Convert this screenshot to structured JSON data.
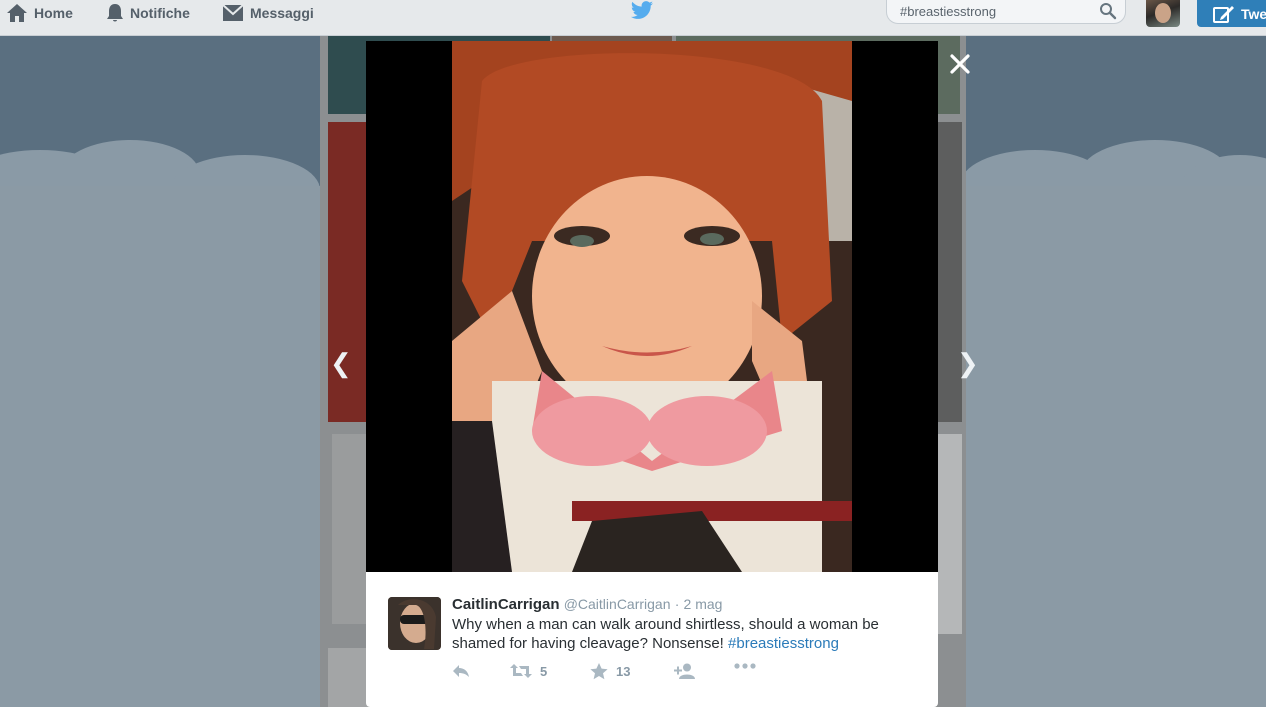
{
  "nav": {
    "home_label": "Home",
    "notifications_label": "Notifiche",
    "messages_label": "Messaggi",
    "tweet_button_label": "Twe"
  },
  "search": {
    "value": "#breastiesstrong"
  },
  "lightbox": {
    "tweet": {
      "display_name": "CaitlinCarrigan",
      "handle": "@CaitlinCarrigan",
      "separator": "·",
      "time": "2 mag",
      "text_plain": "Why when a man can walk around shirtless, should a woman be shamed for having cleavage? Nonsense!",
      "hashtag": "#breastiesstrong",
      "retweet_count": "5",
      "favorite_count": "13"
    }
  },
  "colors": {
    "twitter_blue": "#55acee",
    "link_blue": "#2b7bb9",
    "tweet_button": "#2f7fb8"
  },
  "icons": [
    "home-icon",
    "bell-icon",
    "envelope-icon",
    "twitter-bird-icon",
    "search-icon",
    "close-icon",
    "reply-icon",
    "retweet-icon",
    "star-icon",
    "follow-icon",
    "more-icon",
    "chevron-left-icon",
    "chevron-right-icon"
  ]
}
